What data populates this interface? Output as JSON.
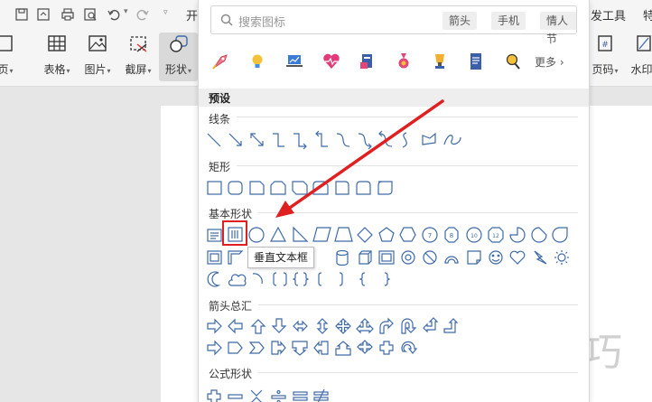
{
  "toolbar": {
    "qa_partial_label": "开",
    "right_tab_partial": "发工具",
    "right_edge_partial": "特",
    "buttons": [
      {
        "label": "页",
        "partial": true
      },
      {
        "label": "表格"
      },
      {
        "label": "图片"
      },
      {
        "label": "截屏"
      },
      {
        "label": "形状",
        "active": true
      },
      {
        "label": "页码"
      },
      {
        "label": "水印"
      }
    ]
  },
  "shape_panel": {
    "search": {
      "placeholder": "搜索图标",
      "tags": [
        "箭头",
        "手机",
        "情人节"
      ]
    },
    "more_label": "更多",
    "icons": [
      "rocket-icon",
      "lightbulb-icon",
      "laptop-chart-icon",
      "heart-pulse-icon",
      "book-icon",
      "medal-icon",
      "trophy-icon",
      "document-icon",
      "magnifier-icon"
    ],
    "preset_label": "预设",
    "sections": [
      {
        "id": "lines",
        "title": "线条",
        "count": 12
      },
      {
        "id": "rectangles",
        "title": "矩形",
        "count": 9
      },
      {
        "id": "basic",
        "title": "基本形状",
        "count": 42
      },
      {
        "id": "arrows",
        "title": "箭头总汇",
        "count": 20
      },
      {
        "id": "formula",
        "title": "公式形状",
        "count": 6
      }
    ],
    "tooltip": "垂直文本框"
  },
  "document": {
    "watermark": "软件技巧"
  },
  "colors": {
    "accent": "#e02020",
    "shape_stroke": "#3f6aa8",
    "toolbar_bg": "#f5f5f6",
    "panel_bg": "#ffffff"
  }
}
